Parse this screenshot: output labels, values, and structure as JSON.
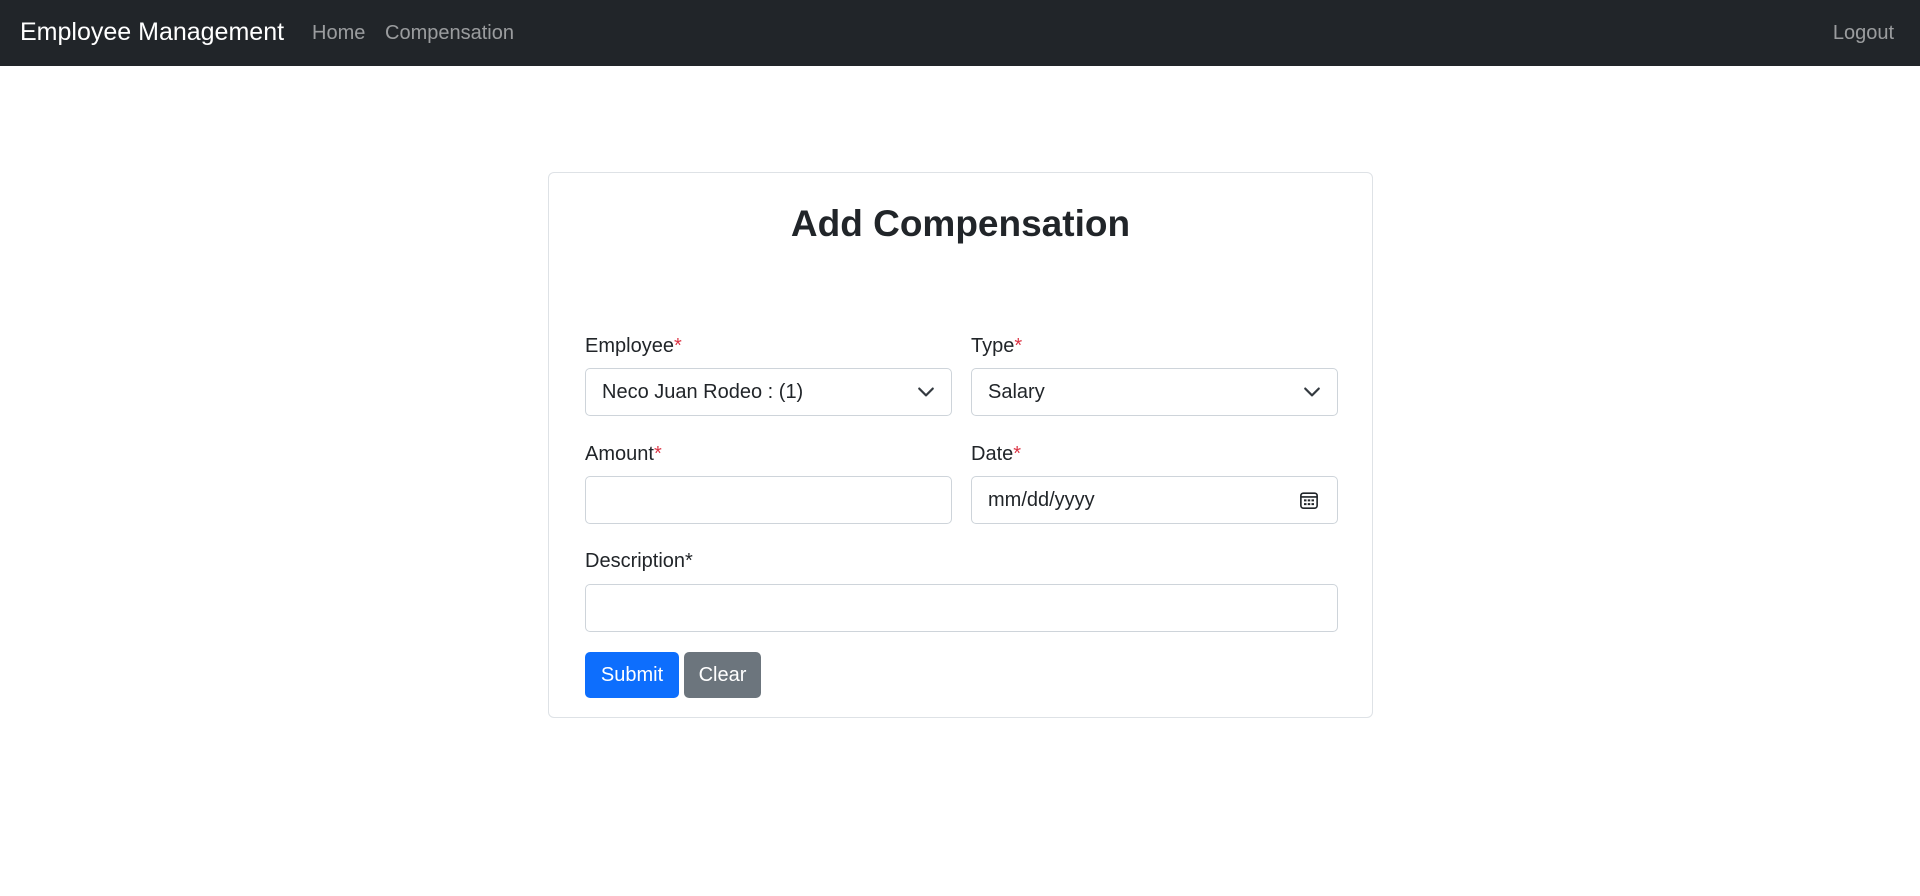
{
  "navbar": {
    "brand": "Employee Management",
    "links": [
      "Home",
      "Compensation"
    ],
    "logout": "Logout"
  },
  "form": {
    "title": "Add Compensation",
    "employee": {
      "label": "Employee",
      "required_mark": "*",
      "value": "Neco Juan Rodeo : (1)"
    },
    "type": {
      "label": "Type",
      "required_mark": "*",
      "value": "Salary"
    },
    "amount": {
      "label": "Amount",
      "required_mark": "*",
      "value": ""
    },
    "date": {
      "label": "Date",
      "required_mark": "*",
      "placeholder": "mm/dd/yyyy"
    },
    "description": {
      "label": "Description*",
      "value": ""
    },
    "submit_label": "Submit",
    "clear_label": "Clear"
  },
  "icons": {
    "select_arrow": "chevron-down-icon",
    "date_picker": "calendar-icon"
  },
  "colors": {
    "navbar_bg": "#212529",
    "primary": "#0d6efd",
    "secondary": "#6c757d",
    "required": "#dc3545"
  }
}
